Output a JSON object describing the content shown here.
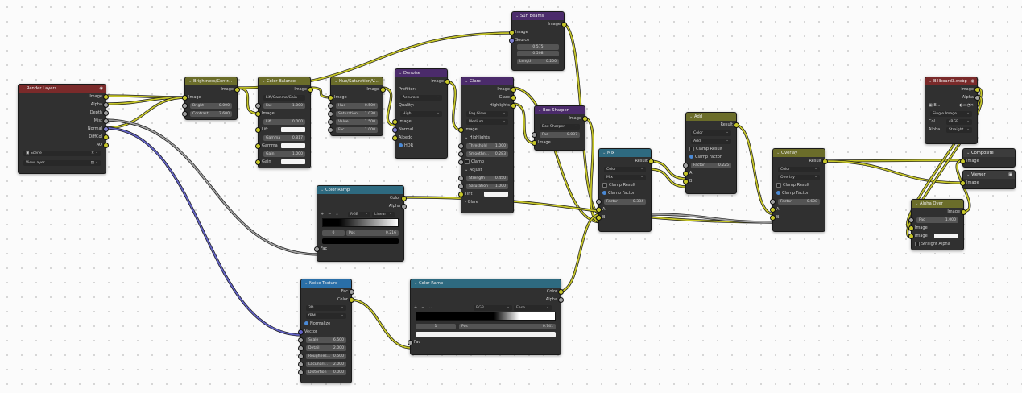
{
  "nodes": {
    "render_layers": {
      "title": "Render Layers",
      "outputs": [
        "Image",
        "Alpha",
        "Depth",
        "Mist",
        "Normal",
        "DiffCol",
        "AO"
      ],
      "scene": "Scene",
      "view_layer": "ViewLayer"
    },
    "brightness": {
      "title": "Brightness/Contr...",
      "out": "Image",
      "in": "Image",
      "bright_label": "Bright",
      "bright": "0.000",
      "contrast_label": "Contrast",
      "contrast": "2.600"
    },
    "color_balance": {
      "title": "Color Balance",
      "out": "Image",
      "mode": "Lift/Gamma/Gain",
      "fac_label": "Fac",
      "fac": "1.000",
      "in": "Image",
      "lift_label": "Lift",
      "lift": "0.000",
      "lift2": "Lift",
      "gamma_label": "Gamma",
      "gamma": "0.817",
      "gamma2": "Gamma",
      "gain_label": "Gain",
      "gain": "1.000",
      "gain2": "Gain"
    },
    "hue_sat": {
      "title": "Hue/Saturation/V...",
      "out": "Image",
      "in": "Image",
      "hue_label": "Hue",
      "hue": "0.500",
      "sat_label": "Saturation",
      "sat": "1.030",
      "val_label": "Value",
      "val": "1.500",
      "fac_label": "Fac",
      "fac": "1.000"
    },
    "denoise": {
      "title": "Denoise",
      "out": "Image",
      "prefilter_label": "Prefilter:",
      "prefilter": "Accurate",
      "quality_label": "Quality:",
      "quality": "High",
      "inputs": [
        "Image",
        "Normal",
        "Albedo"
      ],
      "hdr": "HDR"
    },
    "glare": {
      "title": "Glare",
      "outputs": [
        "Image",
        "Glare",
        "Highlights"
      ],
      "type": "Fog Glow",
      "quality": "Medium",
      "in": "Image",
      "highlights": "Highlights",
      "threshold_label": "Threshold",
      "threshold": "1.000",
      "smooth_label": "Smoothn...",
      "smooth": "0.283",
      "clamp": "Clamp",
      "adjust": "Adjust",
      "strength_label": "Strength",
      "strength": "0.450",
      "saturation_label": "Saturation",
      "saturation": "1.000",
      "tint": "Tint",
      "glare_section": "Glare"
    },
    "sun_beams": {
      "title": "Sun Beams",
      "out": "Image",
      "in": "Image",
      "source_label": "Source",
      "source_x": "0.575",
      "source_y": "0.508",
      "length_label": "Length",
      "length": "0.200"
    },
    "box_sharpen": {
      "title": "Box Sharpen",
      "out": "Image",
      "type": "Box Sharpen",
      "fac_label": "Fac",
      "fac": "0.087",
      "in": "Image"
    },
    "color_ramp1": {
      "title": "Color Ramp",
      "outputs": [
        "Color",
        "Alpha"
      ],
      "plus": "+",
      "minus": "−",
      "drop": "⌄",
      "mode": "RGB",
      "interp": "Linear",
      "index": "0",
      "pos_label": "Pos",
      "pos": "0.216",
      "fac": "Fac"
    },
    "noise_texture": {
      "title": "Noise Texture",
      "outputs": [
        "Fac",
        "Color"
      ],
      "dim": "3D",
      "type": "fBM",
      "normalize": "Normalize",
      "vector": "Vector",
      "scale_label": "Scale",
      "scale": "6.500",
      "detail_label": "Detail",
      "detail": "2.000",
      "rough_label": "Roughnes...",
      "rough": "0.500",
      "lac_label": "Lacunari...",
      "lac": "2.000",
      "dist_label": "Distortion",
      "dist": "0.000"
    },
    "color_ramp2": {
      "title": "Color Ramp",
      "outputs": [
        "Color",
        "Alpha"
      ],
      "plus": "+",
      "minus": "−",
      "drop": "⌄",
      "mode": "RGB",
      "interp": "Ease",
      "index": "1",
      "pos_label": "Pos",
      "pos": "0.741",
      "fac": "Fac"
    },
    "mix": {
      "title": "Mix",
      "out": "Result",
      "dtype": "Color",
      "blend": "Mix",
      "clamp_result": "Clamp Result",
      "clamp_factor": "Clamp Factor",
      "factor_label": "Factor",
      "factor": "0.384",
      "a": "A",
      "b": "B"
    },
    "add": {
      "title": "Add",
      "out": "Result",
      "dtype": "Color",
      "blend": "Add",
      "clamp_result": "Clamp Result",
      "clamp_factor": "Clamp Factor",
      "factor_label": "Factor",
      "factor": "0.225",
      "a": "A",
      "b": "B"
    },
    "overlay": {
      "title": "Overlay",
      "out": "Result",
      "dtype": "Color",
      "blend": "Overlay",
      "clamp_result": "Clamp Result",
      "clamp_factor": "Clamp Factor",
      "factor_label": "Factor",
      "factor": "0.608",
      "a": "A",
      "b": "B"
    },
    "billboard": {
      "title": "Billboard3.webp",
      "outputs": [
        "Image",
        "Alpha"
      ],
      "img_name": "B...",
      "source": "Single Image",
      "col_label": "Col...",
      "col": "sRGB",
      "alpha_label": "Alpha",
      "alpha": "Straight"
    },
    "composite": {
      "title": "Composite",
      "in": "Image"
    },
    "viewer": {
      "title": "Viewer",
      "in": "Image"
    },
    "alpha_over": {
      "title": "Alpha Over",
      "out": "Image",
      "fac_label": "Fac",
      "fac": "1.000",
      "in1": "Image",
      "in2": "Image",
      "straight": "Straight Alpha"
    }
  },
  "wire_colors": {
    "color": "#c7c729",
    "float": "#a1a1a1",
    "vector": "#6363c7"
  },
  "icons": {
    "collapse": "chevron-down-icon",
    "visibility": "eye-icon",
    "scene": "scene-icon",
    "view_layer": "view-layer-icon",
    "close": "close-icon"
  }
}
